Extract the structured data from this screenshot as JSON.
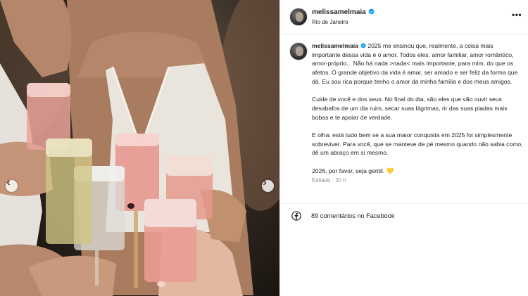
{
  "post": {
    "username": "melissamelmaia",
    "location": "Rio de Janeiro",
    "more_icon": "more-horizontal-icon",
    "verified_icon": "verified-badge-icon",
    "verified_color": "#0095f6"
  },
  "caption": {
    "username": "melissamelmaia",
    "paragraphs": [
      "2025 me ensinou que, realmente, a coisa mais importante dessa vida é o amor. Todos eles: amor familiar, amor romântico, amor-próprio... Não há nada >nada< mais importante, para mim, do que os afetos. O grande objetivo da vida é amar, ser amado e ser feliz da forma que dá. Eu sou rica porque tenho o amor da minha família e dos meus amigos.",
      "Cuide de você e dos seus. No final do dia, são eles que vão ouvir seus desabafos de um dia ruim, secar suas lágrimas, rir das suas piadas mais bobas e te apoiar de verdade.",
      "E olha: está tudo bem se a sua maior conquista em 2025 foi simplesmente sobreviver. Para você, que se manteve de pé mesmo quando não sabia como, dê um abraço em si mesmo.",
      "2026, por favor, seja gentil. 💛"
    ],
    "edited_label": "Editado",
    "separator": "·",
    "time": "20 h"
  },
  "facebook": {
    "icon": "facebook-icon",
    "comments_text": "89 comentários no Facebook"
  },
  "photo": {
    "alt_icon": "photo-of-champagne-toast",
    "prev_icon": "chevron-left-icon",
    "next_icon": "chevron-right-icon"
  }
}
